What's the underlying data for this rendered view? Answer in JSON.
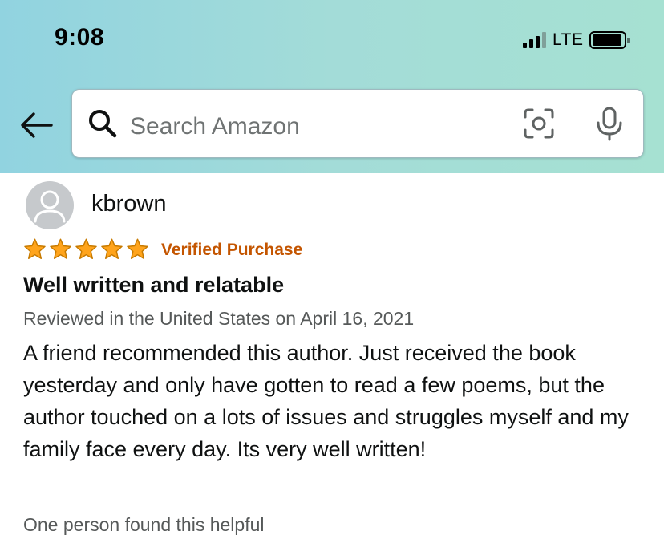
{
  "status_bar": {
    "time": "9:08",
    "network": "LTE",
    "signal_bars": 3,
    "signal_bars_total": 4,
    "battery_level": 0.9
  },
  "header": {
    "back_icon": "back-arrow-icon",
    "search": {
      "placeholder": "Search Amazon",
      "value": "",
      "search_icon": "search-icon",
      "camera_icon": "camera-scan-icon",
      "mic_icon": "microphone-icon"
    }
  },
  "review": {
    "reviewer_name": "kbrown",
    "avatar_icon": "user-avatar-icon",
    "rating": 5,
    "rating_max": 5,
    "verified_label": "Verified Purchase",
    "title": "Well written and relatable",
    "meta": "Reviewed in the United States on April 16, 2021",
    "body": "A friend recommended this author. Just received the book yesterday and only have gotten to read a few poems, but the author touched on a lots of issues and struggles myself and my family face every day. Its very well written!",
    "helpful_text": "One person found this helpful"
  },
  "colors": {
    "header_gradient_start": "#91d3e0",
    "header_gradient_end": "#a6e1d2",
    "star": "#ffa41c",
    "verified": "#c45500",
    "secondary_text": "#565959"
  }
}
